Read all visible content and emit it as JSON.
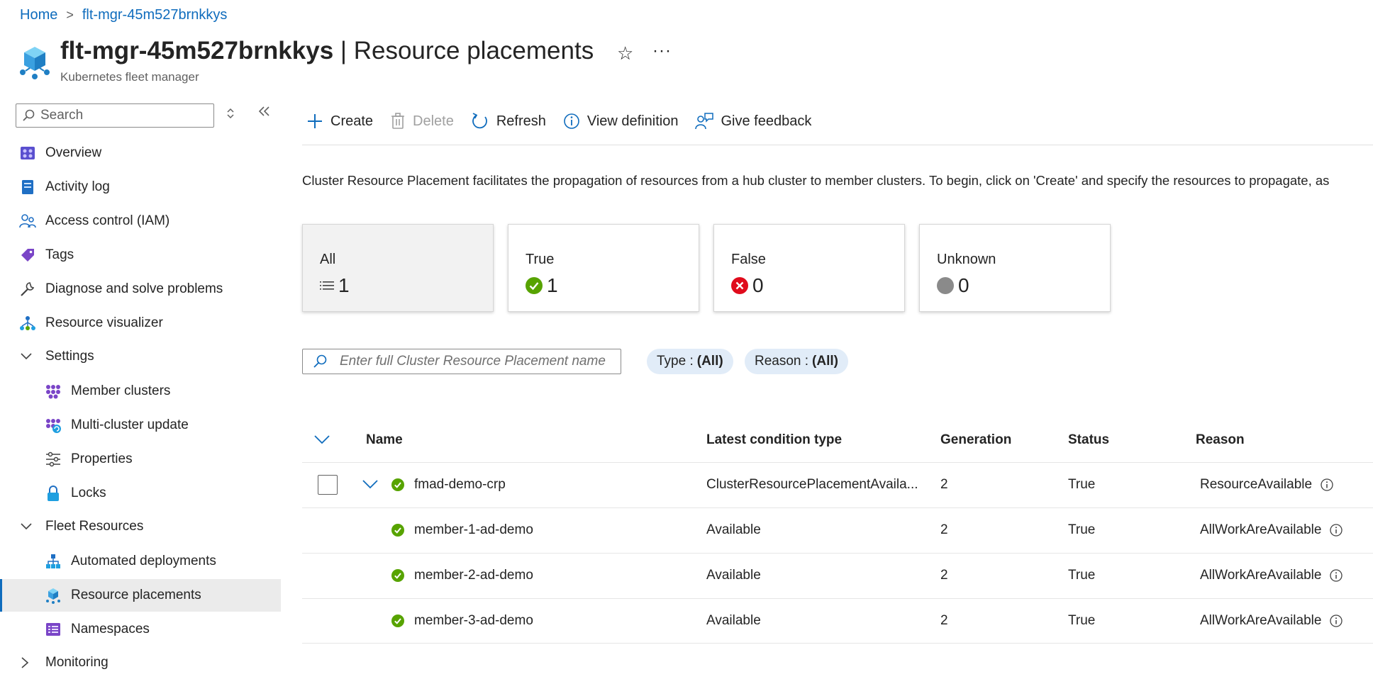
{
  "breadcrumb": {
    "home": "Home",
    "separator": ">",
    "resource": "flt-mgr-45m527brnkkys"
  },
  "header": {
    "resource_name": "flt-mgr-45m527brnkkys",
    "separator": " | ",
    "page_title": "Resource placements",
    "subtitle": "Kubernetes fleet manager",
    "favorite_icon": "☆",
    "more_icon": "···"
  },
  "sidebar": {
    "search_placeholder": "Search",
    "items": [
      {
        "label": "Overview",
        "icon": "overview-icon"
      },
      {
        "label": "Activity log",
        "icon": "activity-log-icon"
      },
      {
        "label": "Access control (IAM)",
        "icon": "iam-icon"
      },
      {
        "label": "Tags",
        "icon": "tag-icon"
      },
      {
        "label": "Diagnose and solve problems",
        "icon": "wrench-icon"
      },
      {
        "label": "Resource visualizer",
        "icon": "visualizer-icon"
      }
    ],
    "groups": [
      {
        "label": "Settings",
        "expanded": true,
        "items": [
          {
            "label": "Member clusters",
            "icon": "member-clusters-icon"
          },
          {
            "label": "Multi-cluster update",
            "icon": "multi-cluster-update-icon"
          },
          {
            "label": "Properties",
            "icon": "properties-icon"
          },
          {
            "label": "Locks",
            "icon": "lock-icon"
          }
        ]
      },
      {
        "label": "Fleet Resources",
        "expanded": true,
        "items": [
          {
            "label": "Automated deployments",
            "icon": "automated-deployments-icon"
          },
          {
            "label": "Resource placements",
            "icon": "resource-placements-icon",
            "active": true
          },
          {
            "label": "Namespaces",
            "icon": "namespaces-icon"
          }
        ]
      },
      {
        "label": "Monitoring",
        "expanded": false,
        "items": []
      }
    ]
  },
  "toolbar": {
    "create": "Create",
    "delete": "Delete",
    "refresh": "Refresh",
    "view_definition": "View definition",
    "give_feedback": "Give feedback"
  },
  "description": "Cluster Resource Placement facilitates the propagation of resources from a hub cluster to member clusters. To begin, click on 'Create' and specify the resources to propagate, as",
  "cards": [
    {
      "label": "All",
      "value": "1",
      "icon": "list-icon",
      "selected": true
    },
    {
      "label": "True",
      "value": "1",
      "icon": "success-icon",
      "color": "#57a300"
    },
    {
      "label": "False",
      "value": "0",
      "icon": "error-icon",
      "color": "#e00b1c"
    },
    {
      "label": "Unknown",
      "value": "0",
      "icon": "unknown-icon",
      "color": "#8a8a8a"
    }
  ],
  "filter": {
    "placeholder": "Enter full Cluster Resource Placement name",
    "pills": [
      {
        "key": "Type :",
        "value": "(All)"
      },
      {
        "key": "Reason :",
        "value": "(All)"
      }
    ]
  },
  "table": {
    "headers": {
      "name": "Name",
      "condition": "Latest condition type",
      "generation": "Generation",
      "status": "Status",
      "reason": "Reason"
    },
    "rows": [
      {
        "name": "fmad-demo-crp",
        "condition": "ClusterResourcePlacementAvaila...",
        "generation": "2",
        "status": "True",
        "reason": "ResourceAvailable",
        "is_parent": true
      },
      {
        "name": "member-1-ad-demo",
        "condition": "Available",
        "generation": "2",
        "status": "True",
        "reason": "AllWorkAreAvailable"
      },
      {
        "name": "member-2-ad-demo",
        "condition": "Available",
        "generation": "2",
        "status": "True",
        "reason": "AllWorkAreAvailable"
      },
      {
        "name": "member-3-ad-demo",
        "condition": "Available",
        "generation": "2",
        "status": "True",
        "reason": "AllWorkAreAvailable"
      }
    ]
  },
  "colors": {
    "accent": "#0f6cbd",
    "success": "#57a300",
    "error": "#e00b1c",
    "unknown": "#8a8a8a",
    "pill_bg": "#e1ecf8"
  }
}
